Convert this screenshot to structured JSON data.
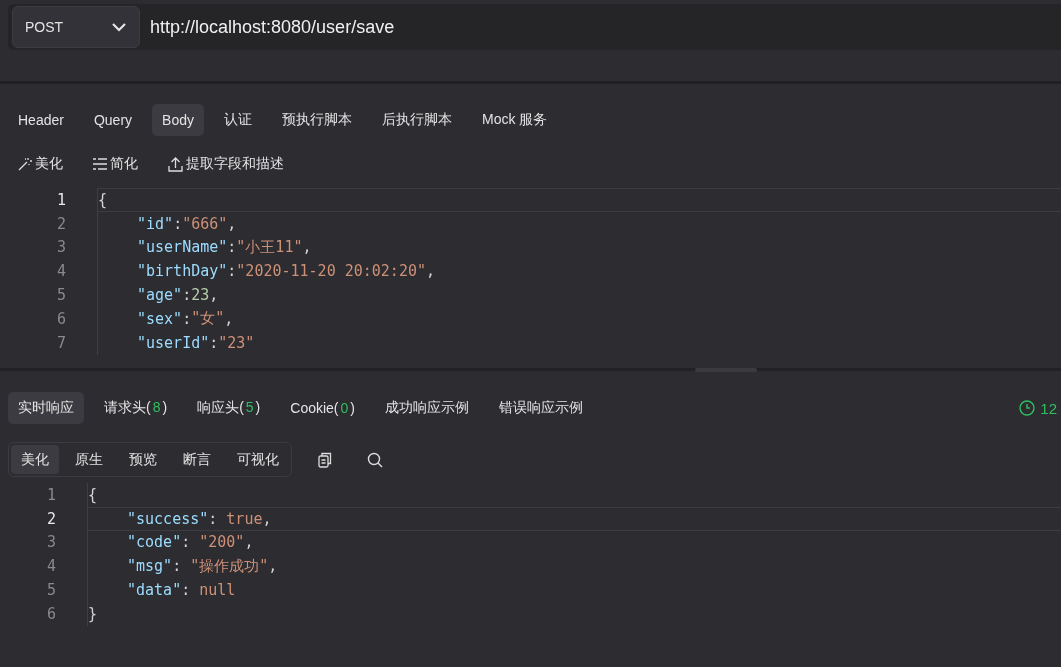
{
  "request": {
    "method": "POST",
    "url": "http://localhost:8080/user/save"
  },
  "request_tabs": [
    {
      "label": "Header",
      "selected": false
    },
    {
      "label": "Query",
      "selected": false
    },
    {
      "label": "Body",
      "selected": true
    },
    {
      "label": "认证",
      "selected": false
    },
    {
      "label": "预执行脚本",
      "selected": false
    },
    {
      "label": "后执行脚本",
      "selected": false
    },
    {
      "label": "Mock 服务",
      "selected": false
    }
  ],
  "body_tools": [
    {
      "kind": "wand",
      "label": "美化"
    },
    {
      "kind": "lines",
      "label": "简化"
    },
    {
      "kind": "upload",
      "label": "提取字段和描述"
    }
  ],
  "request_body": [
    {
      "number": "1",
      "current": true,
      "indented": false,
      "tokens": [
        {
          "kind": "punct",
          "text": "{"
        }
      ]
    },
    {
      "number": "2",
      "current": false,
      "indented": true,
      "tokens": [
        {
          "kind": "key",
          "text": "\"id\""
        },
        {
          "kind": "punct",
          "text": ":"
        },
        {
          "kind": "string",
          "text": "\"666\""
        },
        {
          "kind": "punct",
          "text": ","
        }
      ]
    },
    {
      "number": "3",
      "current": false,
      "indented": true,
      "tokens": [
        {
          "kind": "key",
          "text": "\"userName\""
        },
        {
          "kind": "punct",
          "text": ":"
        },
        {
          "kind": "string",
          "text": "\"小王11\""
        },
        {
          "kind": "punct",
          "text": ","
        }
      ]
    },
    {
      "number": "4",
      "current": false,
      "indented": true,
      "tokens": [
        {
          "kind": "key",
          "text": "\"birthDay\""
        },
        {
          "kind": "punct",
          "text": ":"
        },
        {
          "kind": "string",
          "text": "\"2020-11-20 20:02:20\""
        },
        {
          "kind": "punct",
          "text": ","
        }
      ]
    },
    {
      "number": "5",
      "current": false,
      "indented": true,
      "tokens": [
        {
          "kind": "key",
          "text": "\"age\""
        },
        {
          "kind": "punct",
          "text": ":"
        },
        {
          "kind": "number",
          "text": "23"
        },
        {
          "kind": "punct",
          "text": ","
        }
      ]
    },
    {
      "number": "6",
      "current": false,
      "indented": true,
      "tokens": [
        {
          "kind": "key",
          "text": "\"sex\""
        },
        {
          "kind": "punct",
          "text": ":"
        },
        {
          "kind": "string",
          "text": "\"女\""
        },
        {
          "kind": "punct",
          "text": ","
        }
      ]
    },
    {
      "number": "7",
      "current": false,
      "indented": true,
      "tokens": [
        {
          "kind": "key",
          "text": "\"userId\""
        },
        {
          "kind": "punct",
          "text": ":"
        },
        {
          "kind": "string",
          "text": "\"23\""
        }
      ]
    }
  ],
  "response_tabs": [
    {
      "label": "实时响应",
      "selected": true
    },
    {
      "label": "请求头(",
      "count": "8",
      "close": ")",
      "selected": false
    },
    {
      "label": "响应头(",
      "count": "5",
      "close": ")",
      "selected": false
    },
    {
      "label": "Cookie(",
      "count": "0",
      "close": ")",
      "selected": false
    },
    {
      "label": "成功响应示例",
      "selected": false
    },
    {
      "label": "错误响应示例",
      "selected": false
    }
  ],
  "response_time": "12",
  "view_modes": [
    {
      "label": "美化",
      "selected": true
    },
    {
      "label": "原生",
      "selected": false
    },
    {
      "label": "预览",
      "selected": false
    },
    {
      "label": "断言",
      "selected": false
    },
    {
      "label": "可视化",
      "selected": false
    }
  ],
  "response_body": [
    {
      "number": "1",
      "current": false,
      "indented": false,
      "tokens": [
        {
          "kind": "punct",
          "text": "{"
        }
      ]
    },
    {
      "number": "2",
      "current": true,
      "indented": true,
      "tokens": [
        {
          "kind": "key",
          "text": "\"success\""
        },
        {
          "kind": "punct",
          "text": ": "
        },
        {
          "kind": "keyword",
          "text": "true"
        },
        {
          "kind": "punct",
          "text": ","
        }
      ]
    },
    {
      "number": "3",
      "current": false,
      "indented": true,
      "tokens": [
        {
          "kind": "key",
          "text": "\"code\""
        },
        {
          "kind": "punct",
          "text": ": "
        },
        {
          "kind": "string",
          "text": "\"200\""
        },
        {
          "kind": "punct",
          "text": ","
        }
      ]
    },
    {
      "number": "4",
      "current": false,
      "indented": true,
      "tokens": [
        {
          "kind": "key",
          "text": "\"msg\""
        },
        {
          "kind": "punct",
          "text": ": "
        },
        {
          "kind": "string",
          "text": "\"操作成功\""
        },
        {
          "kind": "punct",
          "text": ","
        }
      ]
    },
    {
      "number": "5",
      "current": false,
      "indented": true,
      "tokens": [
        {
          "kind": "key",
          "text": "\"data\""
        },
        {
          "kind": "punct",
          "text": ": "
        },
        {
          "kind": "keyword",
          "text": "null"
        }
      ]
    },
    {
      "number": "6",
      "current": false,
      "indented": false,
      "tokens": [
        {
          "kind": "punct",
          "text": "}"
        }
      ]
    }
  ]
}
